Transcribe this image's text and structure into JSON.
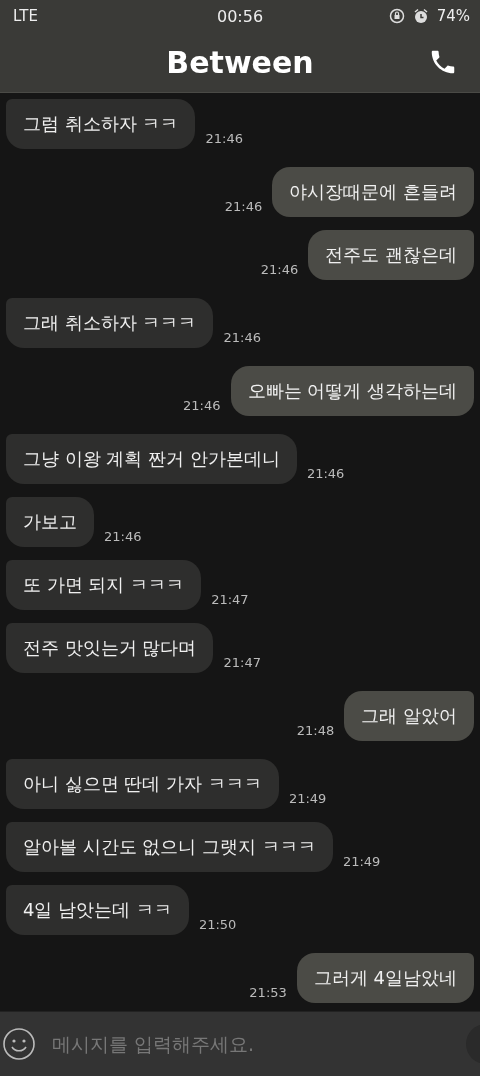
{
  "status_bar": {
    "network": "LTE",
    "time": "00:56",
    "battery": "74%"
  },
  "header": {
    "title": "Between"
  },
  "messages": [
    {
      "kind": "received",
      "text": "그럼 취소하자 ㅋㅋ",
      "time": "21:46"
    },
    {
      "kind": "sent",
      "text": "야시장때문에 흔들려",
      "time": "21:46"
    },
    {
      "kind": "sent",
      "text": "전주도 괜찮은데",
      "time": "21:46"
    },
    {
      "kind": "received",
      "text": "그래 취소하자 ㅋㅋㅋ",
      "time": "21:46"
    },
    {
      "kind": "sent",
      "text": "오빠는 어떻게 생각하는데",
      "time": "21:46"
    },
    {
      "kind": "received",
      "text": "그냥 이왕 계획 짠거 안가본데니",
      "time": "21:46"
    },
    {
      "kind": "received",
      "text": "가보고",
      "time": "21:46"
    },
    {
      "kind": "received",
      "text": "또 가면 되지 ㅋㅋㅋ",
      "time": "21:47"
    },
    {
      "kind": "received",
      "text": "전주 맛잇는거 많다며",
      "time": "21:47"
    },
    {
      "kind": "sent",
      "text": "그래 알았어",
      "time": "21:48"
    },
    {
      "kind": "received",
      "text": "아니 싫으면 딴데 가자 ㅋㅋㅋ",
      "time": "21:49"
    },
    {
      "kind": "received",
      "text": "알아볼 시간도 없으니 그랫지 ㅋㅋㅋ",
      "time": "21:49"
    },
    {
      "kind": "received",
      "text": "4일 남앗는데 ㅋㅋ",
      "time": "21:50"
    },
    {
      "kind": "sent",
      "text": "그러게 4일남았네",
      "time": "21:53"
    }
  ],
  "composer": {
    "placeholder": "메시지를 입력해주세요."
  }
}
